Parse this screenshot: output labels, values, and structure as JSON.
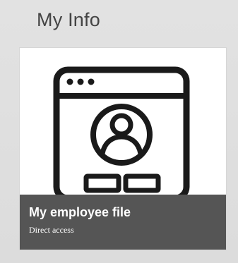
{
  "section": {
    "title": "My Info"
  },
  "tile": {
    "title": "My employee file",
    "subtitle": "Direct access",
    "icon": "employee-profile-window-icon"
  },
  "colors": {
    "background": "#dedede",
    "tile_background": "#ffffff",
    "footer_background": "#555555",
    "icon_stroke": "#1a1a1a",
    "title_text": "#444444"
  }
}
